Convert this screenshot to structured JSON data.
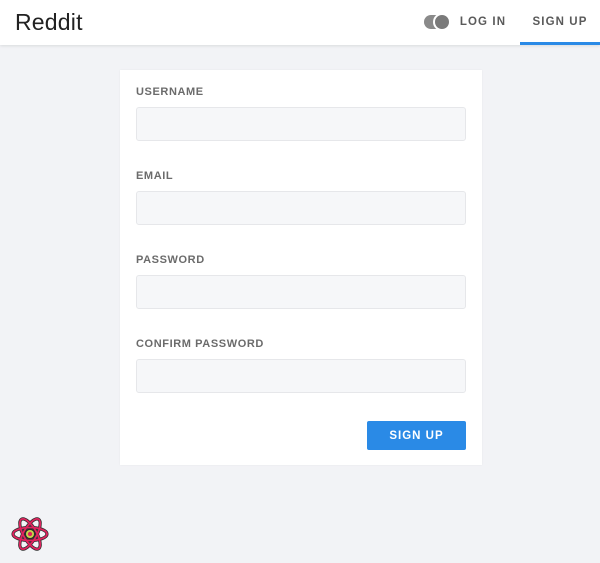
{
  "header": {
    "brand": "Reddit",
    "nav": {
      "login": "LOG IN",
      "signup": "SIGN UP",
      "active": "signup"
    },
    "theme_toggle_icon": "dark-mode-toggle-icon"
  },
  "form": {
    "fields": [
      {
        "label": "USERNAME",
        "value": "",
        "placeholder": ""
      },
      {
        "label": "EMAIL",
        "value": "",
        "placeholder": ""
      },
      {
        "label": "PASSWORD",
        "value": "",
        "placeholder": ""
      },
      {
        "label": "CONFIRM PASSWORD",
        "value": "",
        "placeholder": ""
      }
    ],
    "submit_label": "SIGN UP"
  },
  "footer": {
    "logo_icon": "react-devtools-icon"
  },
  "colors": {
    "accent": "#2a8ae6",
    "background": "#f2f3f6",
    "react_logo": "#e0245e"
  }
}
